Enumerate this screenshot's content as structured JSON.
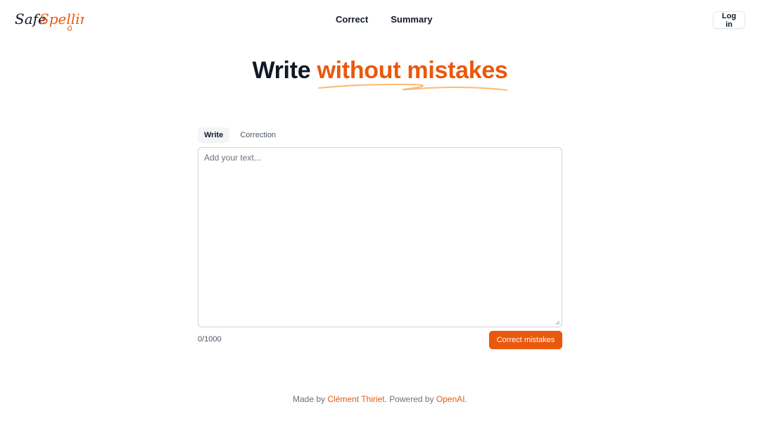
{
  "brand": {
    "name_part1": "Safe",
    "name_part2": "Spelling",
    "accent_color": "#ea580c"
  },
  "nav": {
    "items": [
      {
        "label": "Correct"
      },
      {
        "label": "Summary"
      }
    ]
  },
  "header": {
    "login_label": "Log in"
  },
  "hero": {
    "title_plain": "Write",
    "title_accent": "without mistakes"
  },
  "editor": {
    "tabs": [
      {
        "label": "Write",
        "active": true
      },
      {
        "label": "Correction",
        "active": false
      }
    ],
    "placeholder": "Add your text...",
    "value": "",
    "counter": "0/1000",
    "submit_label": "Correct mistakes"
  },
  "footer": {
    "made_by_prefix": "Made by",
    "author": "Clément Thiriet",
    "powered_prefix": ". Powered by",
    "powered_by": "OpenAI",
    "suffix": "."
  },
  "colors": {
    "accent": "#ea580c",
    "text": "#111827",
    "muted": "#6b7280",
    "border": "#d1d5db"
  }
}
